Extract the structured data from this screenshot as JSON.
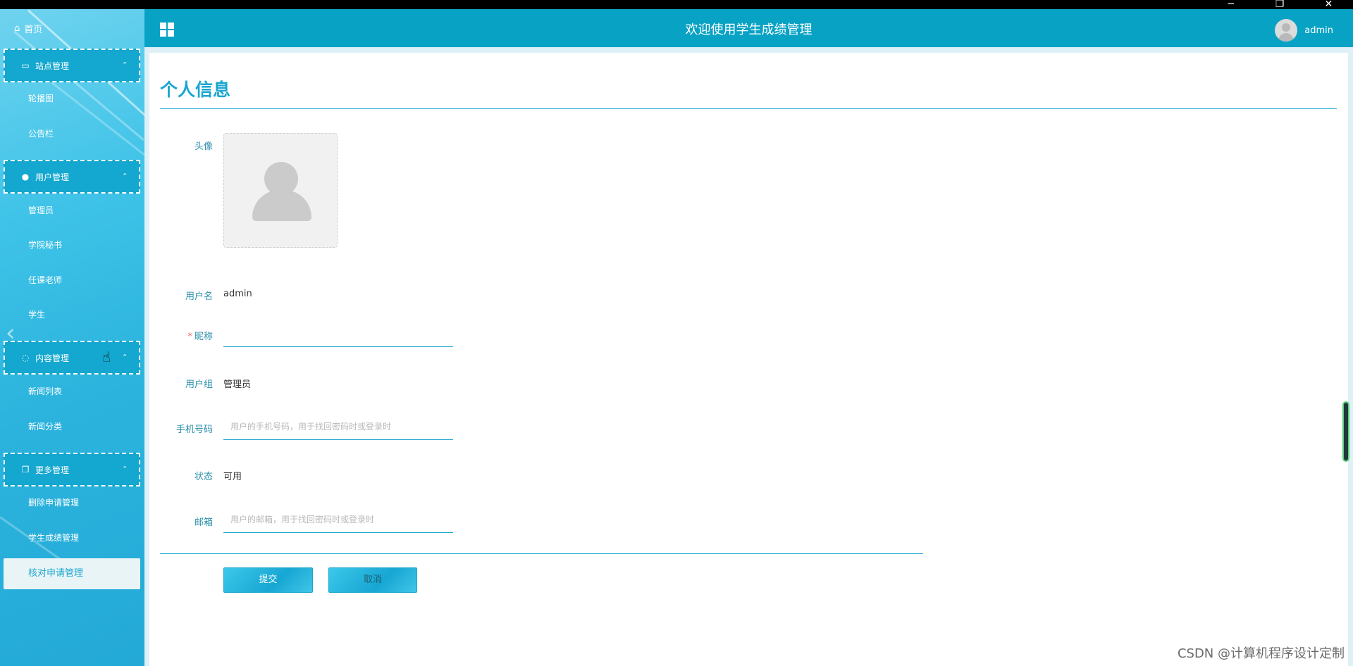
{
  "window": {
    "minimize": "─",
    "restore": "❐",
    "close": "✕"
  },
  "sidebar": {
    "home_label": "首页",
    "groups": [
      {
        "label": "站点管理",
        "items": [
          "轮播图",
          "公告栏"
        ]
      },
      {
        "label": "用户管理",
        "items": [
          "管理员",
          "学院秘书",
          "任课老师",
          "学生"
        ]
      },
      {
        "label": "内容管理",
        "items": [
          "新闻列表",
          "新闻分类"
        ]
      },
      {
        "label": "更多管理",
        "items": [
          "删除申请管理",
          "学生成绩管理",
          "核对申请管理"
        ]
      }
    ],
    "active_item": "核对申请管理"
  },
  "header": {
    "title": "欢迎使用学生成绩管理",
    "username": "admin"
  },
  "page": {
    "title": "个人信息",
    "form": {
      "avatar_label": "头像",
      "username_label": "用户名",
      "username_value": "admin",
      "nickname_label": "昵称",
      "nickname_value": "",
      "usergroup_label": "用户组",
      "usergroup_value": "管理员",
      "phone_label": "手机号码",
      "phone_placeholder": "用户的手机号码，用于找回密码时或登录时",
      "status_label": "状态",
      "status_value": "可用",
      "email_label": "邮箱",
      "email_placeholder": "用户的邮箱，用于找回密码时或登录时",
      "submit_label": "提交",
      "cancel_label": "取消"
    }
  },
  "watermark": "CSDN @计算机程序设计定制"
}
